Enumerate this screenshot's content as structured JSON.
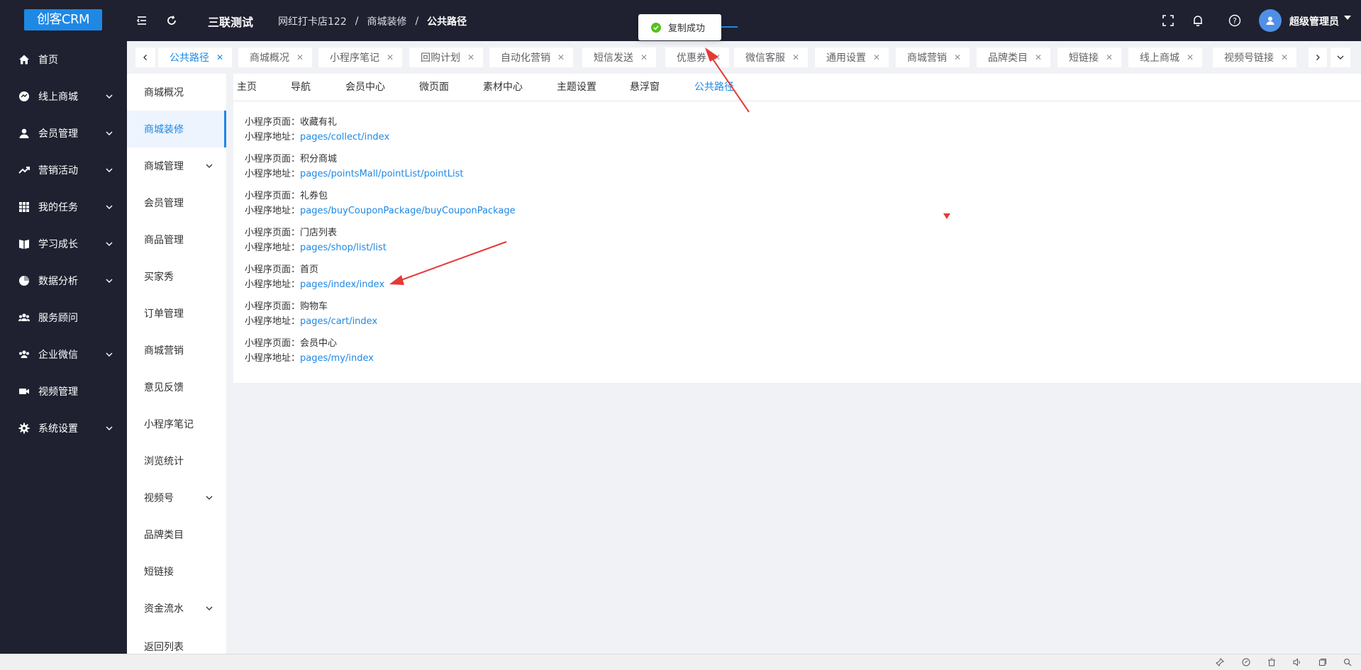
{
  "header": {
    "logo": "创客CRM",
    "company": "三联测试",
    "breadcrumb": [
      "网红打卡店122",
      "/",
      "商城装修",
      "/",
      "公共路径"
    ],
    "user": "超级管理员"
  },
  "toast": {
    "text": "复制成功"
  },
  "sidebar": {
    "items": [
      {
        "label": "首页",
        "icon": "home-icon"
      },
      {
        "label": "线上商城",
        "icon": "shop-icon"
      },
      {
        "label": "会员管理",
        "icon": "user-icon"
      },
      {
        "label": "营销活动",
        "icon": "trend-icon"
      },
      {
        "label": "我的任务",
        "icon": "grid-icon"
      },
      {
        "label": "学习成长",
        "icon": "book-icon"
      },
      {
        "label": "数据分析",
        "icon": "pie-icon"
      },
      {
        "label": "服务顾问",
        "icon": "team-icon"
      },
      {
        "label": "企业微信",
        "icon": "wechat-icon"
      },
      {
        "label": "视频管理",
        "icon": "video-icon"
      },
      {
        "label": "系统设置",
        "icon": "gear-icon"
      }
    ]
  },
  "tabs": [
    {
      "label": "公共路径",
      "active": true
    },
    {
      "label": "商城概况"
    },
    {
      "label": "小程序笔记"
    },
    {
      "label": "回购计划"
    },
    {
      "label": "自动化营销"
    },
    {
      "label": "短信发送"
    },
    {
      "label": "优惠券"
    },
    {
      "label": "微信客服"
    },
    {
      "label": "通用设置"
    },
    {
      "label": "商城营销"
    },
    {
      "label": "品牌类目"
    },
    {
      "label": "短链接"
    },
    {
      "label": "线上商城"
    },
    {
      "label": "视频号链接"
    }
  ],
  "submenu": {
    "items": [
      {
        "label": "商城概况"
      },
      {
        "label": "商城装修",
        "active": true
      },
      {
        "label": "商城管理",
        "expandable": true
      },
      {
        "label": "会员管理"
      },
      {
        "label": "商品管理"
      },
      {
        "label": "买家秀"
      },
      {
        "label": "订单管理"
      },
      {
        "label": "商城营销"
      },
      {
        "label": "意见反馈"
      },
      {
        "label": "小程序笔记"
      },
      {
        "label": "浏览统计"
      },
      {
        "label": "视频号",
        "expandable": true
      },
      {
        "label": "品牌类目"
      },
      {
        "label": "短链接"
      },
      {
        "label": "资金流水",
        "expandable": true
      },
      {
        "label": "返回列表"
      }
    ]
  },
  "content_tabs": [
    "主页",
    "导航",
    "会员中心",
    "微页面",
    "素材中心",
    "主题设置",
    "悬浮窗",
    "公共路径"
  ],
  "paths": {
    "page_label": "小程序页面：",
    "addr_label": "小程序地址：",
    "items": [
      {
        "page": "收藏有礼",
        "addr": "pages/collect/index"
      },
      {
        "page": "积分商城",
        "addr": "pages/pointsMall/pointList/pointList"
      },
      {
        "page": "礼券包",
        "addr": "pages/buyCouponPackage/buyCouponPackage"
      },
      {
        "page": "门店列表",
        "addr": "pages/shop/list/list"
      },
      {
        "page": "首页",
        "addr": "pages/index/index"
      },
      {
        "page": "购物车",
        "addr": "pages/cart/index"
      },
      {
        "page": "会员中心",
        "addr": "pages/my/index"
      }
    ]
  },
  "colors": {
    "accent": "#1e88e5",
    "header_bg": "#1f2130",
    "annotation": "#e53935",
    "success": "#52c41a"
  }
}
